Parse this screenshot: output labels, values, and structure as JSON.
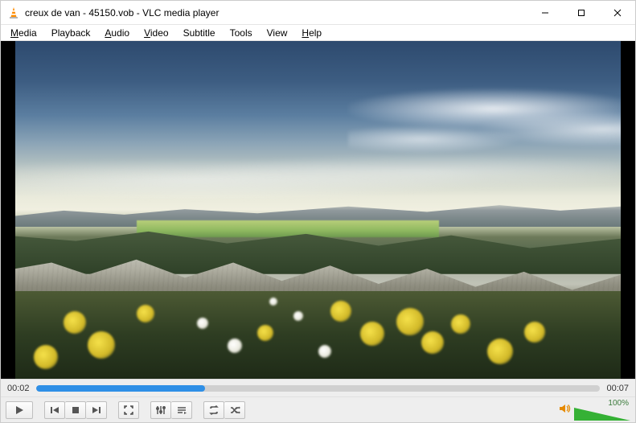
{
  "window": {
    "title": "creux de van - 45150.vob - VLC media player"
  },
  "menu": {
    "items": [
      {
        "label": "Media",
        "accel": "M"
      },
      {
        "label": "Playback",
        "accel": null
      },
      {
        "label": "Audio",
        "accel": "A"
      },
      {
        "label": "Video",
        "accel": "V"
      },
      {
        "label": "Subtitle",
        "accel": null
      },
      {
        "label": "Tools",
        "accel": null
      },
      {
        "label": "View",
        "accel": null
      },
      {
        "label": "Help",
        "accel": "H"
      }
    ]
  },
  "playback": {
    "elapsed": "00:02",
    "total": "00:07",
    "progress_percent": 30
  },
  "volume": {
    "percent_label": "100%",
    "level": 100
  },
  "colors": {
    "seek_fill": "#2f8fe6",
    "volume_fill": "#35b135"
  }
}
